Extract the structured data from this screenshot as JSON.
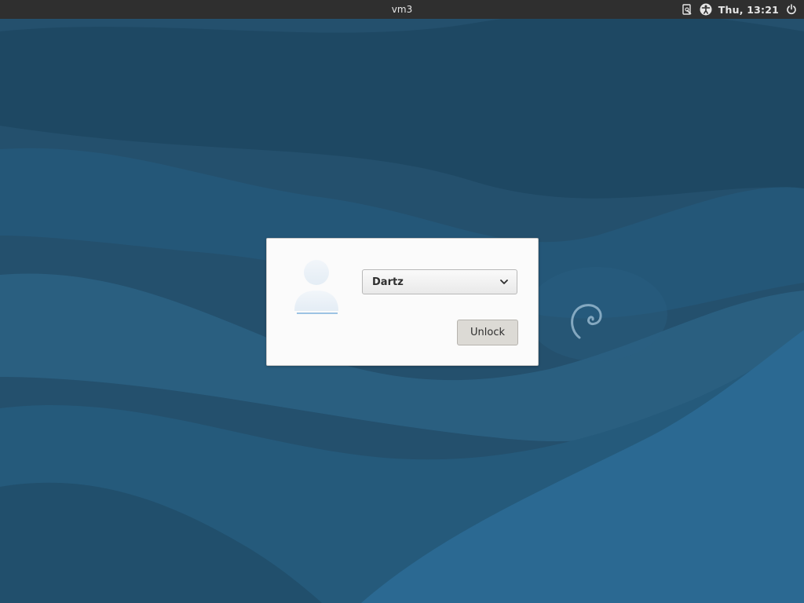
{
  "topbar": {
    "hostname": "vm3",
    "clock": "Thu, 13:21",
    "icons": [
      "screen-share-icon",
      "accessibility-icon",
      "power-icon"
    ]
  },
  "lock_dialog": {
    "selected_user": "Dartz",
    "unlock_label": "Unlock",
    "avatar_icon": "user-avatar-icon"
  },
  "colors": {
    "topbar_bg": "#2f2f2f",
    "wallpaper_dark": "#1f4e6b",
    "wallpaper_light": "#2a6a92",
    "dialog_bg": "#fbfbfb",
    "button_bg": "#dcdad5"
  },
  "wallpaper": {
    "logo": "debian-swirl-icon"
  }
}
